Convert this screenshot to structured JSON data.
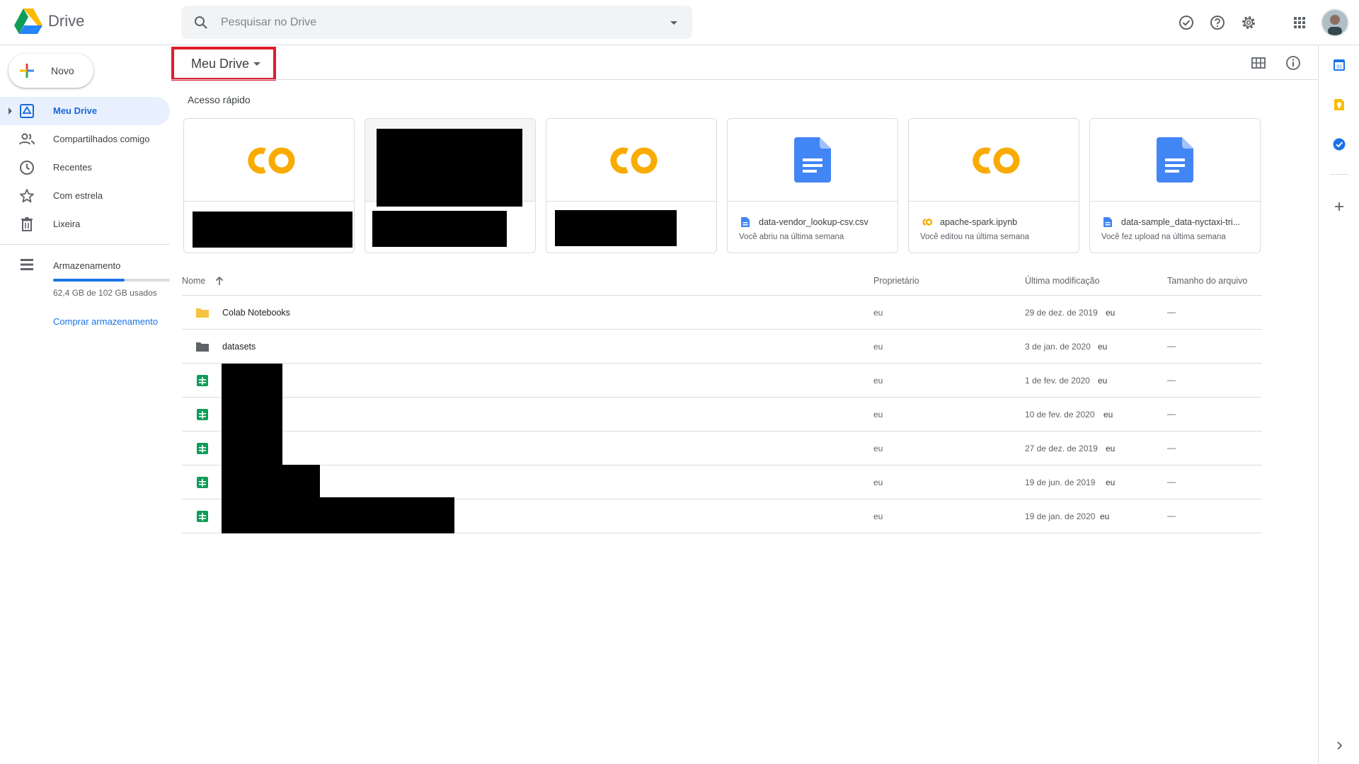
{
  "header": {
    "app_name": "Drive",
    "search_placeholder": "Pesquisar no Drive",
    "icons": [
      "offline-ready-icon",
      "help-icon",
      "settings-icon",
      "apps-grid-icon",
      "avatar"
    ]
  },
  "sidebar": {
    "new_label": "Novo",
    "items": [
      {
        "label": "Meu Drive",
        "icon": "my-drive-icon",
        "active": true
      },
      {
        "label": "Compartilhados comigo",
        "icon": "shared-icon",
        "active": false
      },
      {
        "label": "Recentes",
        "icon": "clock-icon",
        "active": false
      },
      {
        "label": "Com estrela",
        "icon": "star-icon",
        "active": false
      },
      {
        "label": "Lixeira",
        "icon": "trash-icon",
        "active": false
      }
    ],
    "storage": {
      "label": "Armazenamento",
      "used_text": "62,4 GB de 102 GB usados",
      "used_fraction": 0.61,
      "buy_label": "Comprar armazenamento"
    }
  },
  "main": {
    "breadcrumb": "Meu Drive",
    "quick_access_title": "Acesso rápido",
    "quick_access": [
      {
        "type": "colab",
        "name": "",
        "subtitle": "",
        "redacted": true
      },
      {
        "type": "image",
        "name": "",
        "subtitle": "",
        "redacted": true
      },
      {
        "type": "colab",
        "name": "",
        "subtitle": "",
        "redacted": true
      },
      {
        "type": "doc",
        "name": "data-vendor_lookup-csv.csv",
        "subtitle": "Você abriu na última semana",
        "redacted": false
      },
      {
        "type": "colab",
        "name": "apache-spark.ipynb",
        "subtitle": "Você editou na última semana",
        "redacted": false
      },
      {
        "type": "doc",
        "name": "data-sample_data-nyctaxi-tri...",
        "subtitle": "Você fez upload na última semana",
        "redacted": false
      }
    ],
    "columns": {
      "name": "Nome",
      "owner": "Proprietário",
      "modified": "Última modificação",
      "size": "Tamanho do arquivo"
    },
    "files": [
      {
        "type": "folder-yellow",
        "name": "Colab Notebooks",
        "owner": "eu",
        "modified": "29 de dez. de 2019",
        "modified_by": "eu",
        "size": "—"
      },
      {
        "type": "folder-gray",
        "name": "datasets",
        "owner": "eu",
        "modified": "3 de jan. de 2020",
        "modified_by": "eu",
        "size": "—"
      },
      {
        "type": "sheet",
        "name": "",
        "owner": "eu",
        "modified": "1 de fev. de 2020",
        "modified_by": "eu",
        "size": "—"
      },
      {
        "type": "sheet",
        "name": "",
        "owner": "eu",
        "modified": "10 de fev. de 2020",
        "modified_by": "eu",
        "size": "—"
      },
      {
        "type": "sheet",
        "name": "",
        "owner": "eu",
        "modified": "27 de dez. de 2019",
        "modified_by": "eu",
        "size": "—"
      },
      {
        "type": "sheet",
        "name": "",
        "owner": "eu",
        "modified": "19 de jun. de 2019",
        "modified_by": "eu",
        "size": "—"
      },
      {
        "type": "sheet",
        "name": "",
        "owner": "eu",
        "modified": "19 de jan. de 2020",
        "modified_by": "eu",
        "size": "—"
      }
    ]
  },
  "side_panel": {
    "icons": [
      "calendar-icon",
      "keep-icon",
      "tasks-icon",
      "add-addon-icon",
      "expand-panel-icon"
    ],
    "calendar_day": "31"
  }
}
